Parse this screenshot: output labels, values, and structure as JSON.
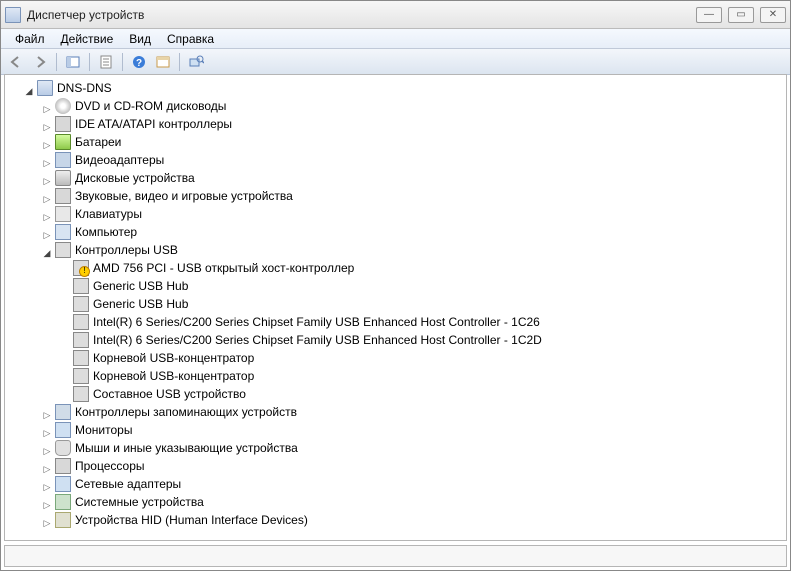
{
  "title": "Диспетчер устройств",
  "menu": {
    "file": "Файл",
    "action": "Действие",
    "view": "Вид",
    "help": "Справка"
  },
  "toolbar": {
    "back": "back",
    "forward": "forward",
    "show_hide": "show-hide",
    "properties": "properties",
    "help": "help",
    "refresh": "refresh",
    "scan": "scan"
  },
  "tree": {
    "root": "DNS-DNS",
    "cats": {
      "dvd": "DVD и CD-ROM дисководы",
      "ide": "IDE ATA/ATAPI контроллеры",
      "battery": "Батареи",
      "video": "Видеоадаптеры",
      "disk": "Дисковые устройства",
      "audio": "Звуковые, видео и игровые устройства",
      "keyboard": "Клавиатуры",
      "computer": "Компьютер",
      "usb": "Контроллеры USB",
      "storage": "Контроллеры запоминающих устройств",
      "monitor": "Мониторы",
      "mouse": "Мыши и иные указывающие устройства",
      "cpu": "Процессоры",
      "net": "Сетевые адаптеры",
      "sys": "Системные устройства",
      "hid": "Устройства HID (Human Interface Devices)"
    },
    "usb_children": {
      "amd": "AMD 756 PCI - USB открытый хост-контроллер",
      "hub1": "Generic USB Hub",
      "hub2": "Generic USB Hub",
      "intel1": "Intel(R) 6 Series/C200 Series Chipset Family USB Enhanced Host Controller - 1C26",
      "intel2": "Intel(R) 6 Series/C200 Series Chipset Family USB Enhanced Host Controller - 1C2D",
      "root1": "Корневой USB-концентратор",
      "root2": "Корневой USB-концентратор",
      "composite": "Составное USB устройство"
    }
  }
}
